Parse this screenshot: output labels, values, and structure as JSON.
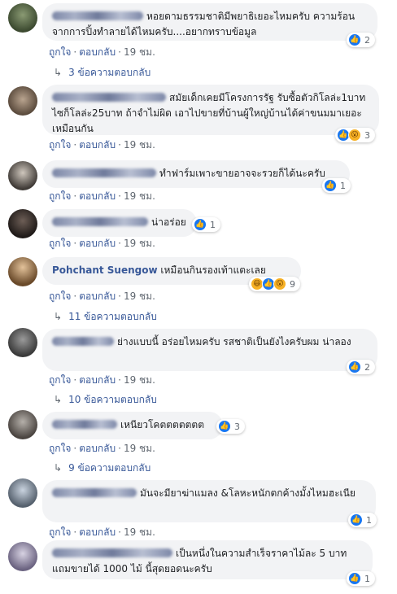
{
  "comments": [
    {
      "name": "",
      "body": "หอยดามธรรมชาติมีพยาธิเยอะไหมครับ ความร้อนจากการปิ้งทำลายได้ไหมครับ....อยากทราบข้อมูล",
      "like": "ถูกใจ",
      "reply": "ตอบกลับ",
      "time": "19 ชม.",
      "reactions": 2,
      "replies": "3 ข้อความตอบกลับ"
    },
    {
      "name": "",
      "body": "สมัยเด็กเคยมีโครงการรัฐ รับซื้อตัวกิโลล่ะ1บาท ไซก็โลล่ะ25บาท ถ้าจำไม่ผิด เอาไปขายที่บ้านผู้ใหญ่บ้านได้ค่าขนมมาเยอะเหมือนกัน",
      "like": "ถูกใจ",
      "reply": "ตอบกลับ",
      "time": "19 ชม.",
      "reactions": 3
    },
    {
      "name": "",
      "body": "ทำฟาร์มเพาะขายอาจจะรวยก็ได้นะครับ",
      "like": "ถูกใจ",
      "reply": "ตอบกลับ",
      "time": "19 ชม.",
      "reactions": 1
    },
    {
      "name": "",
      "body": "น่าอร่อย",
      "like": "ถูกใจ",
      "reply": "ตอบกลับ",
      "time": "19 ชม.",
      "reactions": 1
    },
    {
      "name": "Pohchant Suengow",
      "body": "เหมือนกินรองเท้าแตะเลย",
      "like": "ถูกใจ",
      "reply": "ตอบกลับ",
      "time": "19 ชม.",
      "reactions": 9,
      "replies": "11 ข้อความตอบกลับ"
    },
    {
      "name": "",
      "body": "ย่างแบบนี้ อร่อยไหมครับ รสชาติเป็นยังไงครับผม น่าลอง",
      "like": "ถูกใจ",
      "reply": "ตอบกลับ",
      "time": "19 ชม.",
      "reactions": 2,
      "replies": "10 ข้อความตอบกลับ"
    },
    {
      "name": "",
      "body": "เหนียวโคตตตตตตต",
      "like": "ถูกใจ",
      "reply": "ตอบกลับ",
      "time": "19 ชม.",
      "reactions": 3,
      "replies": "9 ข้อความตอบกลับ"
    },
    {
      "name": "",
      "body": "มันจะมียาฆ่าแมลง &โลหะหนักตกค้างมั้งไหมฮะเนีย",
      "like": "ถูกใจ",
      "reply": "ตอบกลับ",
      "time": "19 ชม.",
      "reactions": 1
    },
    {
      "name": "",
      "body": "เป็นหนึ่งในความสำเร็จราคาไม้ละ 5 บาท แถมขายได้ 1000 ไม้ นี้สุดยอดนะครับ",
      "like": "ถูกใจ",
      "reply": "ตอบกลับ",
      "time": "19 ชม.",
      "reactions": 1
    }
  ],
  "separator": "·",
  "icons": {
    "like": "thumbs-up-icon",
    "haha": "haha-icon",
    "wow": "wow-icon",
    "reply_arrow": "reply-arrow-icon"
  },
  "colors": {
    "bubble": "#f2f3f5",
    "link": "#385898",
    "meta": "#606770",
    "like": "#1877f2"
  }
}
